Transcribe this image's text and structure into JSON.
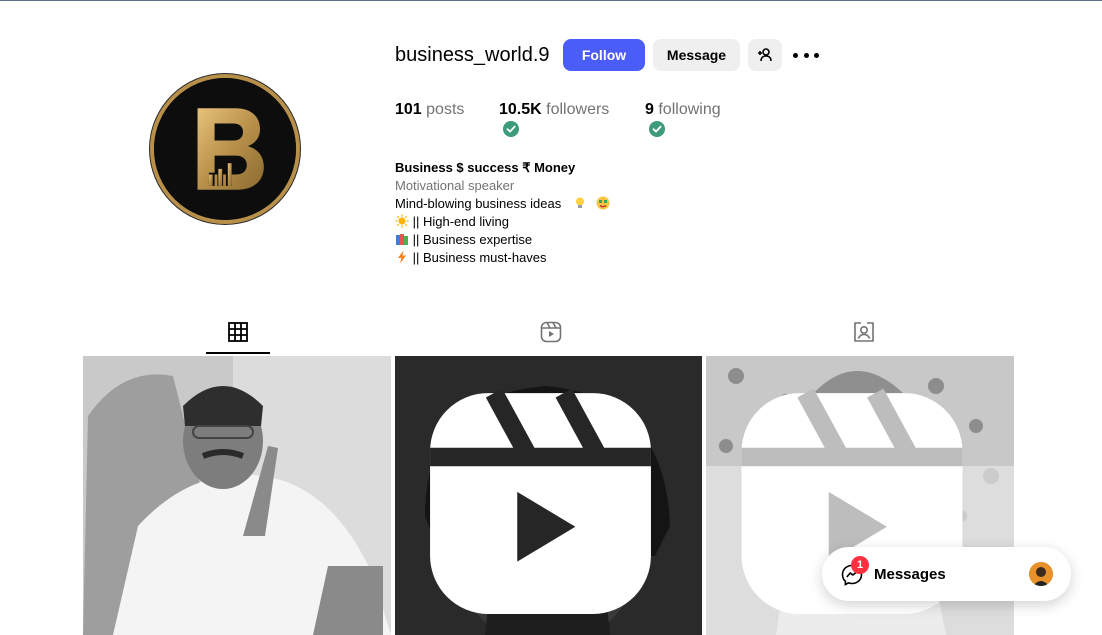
{
  "profile": {
    "username": "business_world.9",
    "follow_label": "Follow",
    "message_label": "Message",
    "avatar_letter": "B",
    "brand_gold": "#b8904a"
  },
  "stats": {
    "posts_count": "101",
    "posts_label": "posts",
    "followers_count": "10.5K",
    "followers_label": "followers",
    "following_count": "9",
    "following_label": "following"
  },
  "bio": {
    "name": "Business $ success ₹ Money",
    "category": "Motivational speaker",
    "line1": "Mind-blowing business ideas",
    "line2": "|| High-end living",
    "line3": "|| Business expertise",
    "line4": "|| Business must-haves"
  },
  "tabs": [
    {
      "icon": "grid-icon",
      "active": true
    },
    {
      "icon": "reels-icon",
      "active": false
    },
    {
      "icon": "tagged-icon",
      "active": false
    }
  ],
  "posts": [
    {
      "type": "photo"
    },
    {
      "type": "reel"
    },
    {
      "type": "reel"
    }
  ],
  "messages": {
    "label": "Messages",
    "unread_count": "1"
  },
  "colors": {
    "follow_button": "#4a5df9",
    "badge_red": "#ff3040",
    "check_green": "#3d9a7b"
  }
}
